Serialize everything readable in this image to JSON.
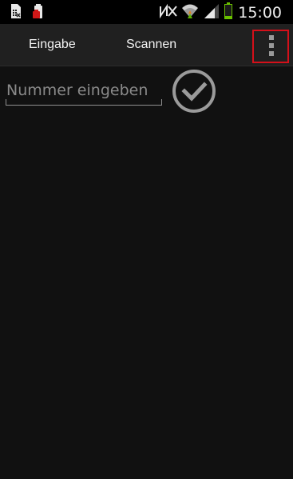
{
  "status_bar": {
    "time": "15:00",
    "icons": [
      "sim-card-icon",
      "battery-alert-icon",
      "no-signal-icon",
      "wifi-icon",
      "signal-strength-icon",
      "battery-icon"
    ],
    "battery_color": "#6ac000"
  },
  "action_bar": {
    "tabs": [
      {
        "label": "Eingabe"
      },
      {
        "label": "Scannen"
      }
    ],
    "overflow_icon": "overflow-menu-icon",
    "highlight_color": "#d4101a"
  },
  "main": {
    "number_input": {
      "value": "",
      "placeholder": "Nummer eingeben"
    },
    "confirm_icon": "checkmark-circle-icon"
  }
}
